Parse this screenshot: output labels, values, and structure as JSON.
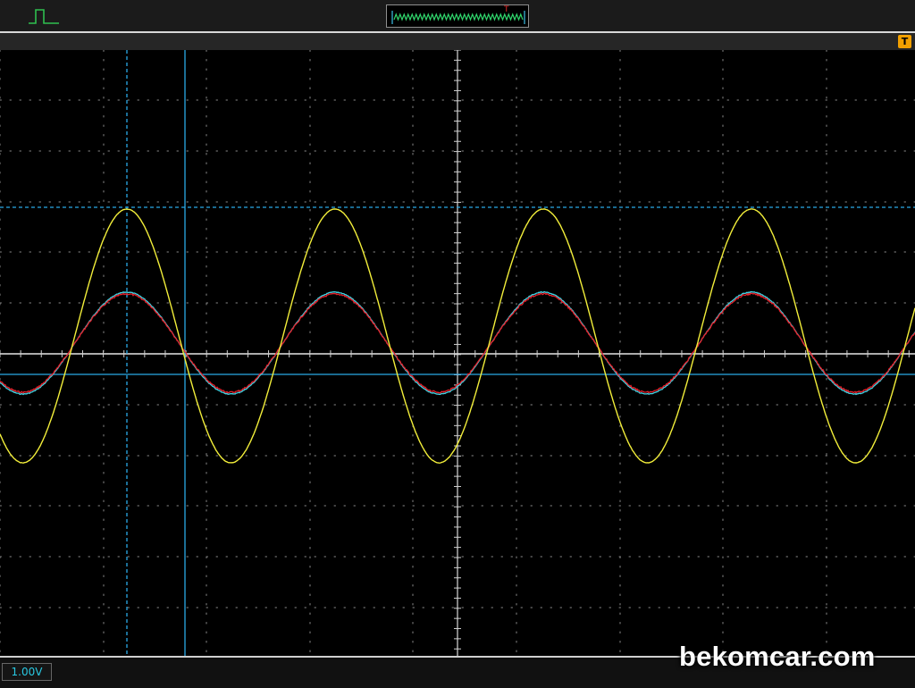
{
  "toolbar": {
    "pulse_icon": "square-pulse-icon",
    "trigger_preview_marker": "T",
    "trigger_level_marker": "T"
  },
  "colors": {
    "channel_1": "#f2ee3a",
    "channel_2": "#e8202a",
    "channel_3": "#3fd6e6",
    "cursor": "#2aa9e6",
    "marker": "#f2a000"
  },
  "status": {
    "volts_per_div": "1.00V"
  },
  "watermark": "bekomcar.com"
}
